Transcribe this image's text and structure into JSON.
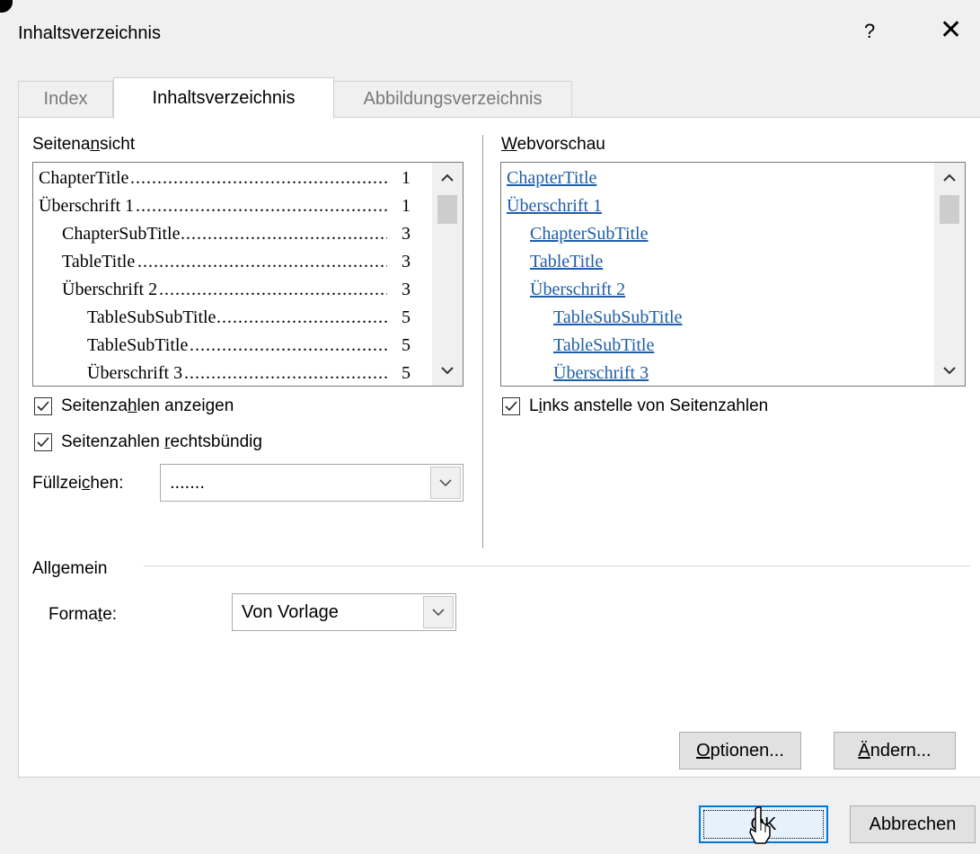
{
  "dialog": {
    "title": "Inhaltsverzeichnis",
    "help_glyph": "?",
    "close_glyph": "✕"
  },
  "tabs": [
    {
      "label": "Index",
      "active": false
    },
    {
      "label": "Inhaltsverzeichnis",
      "active": true
    },
    {
      "label": "Abbildungsverzeichnis",
      "active": false
    }
  ],
  "print_preview": {
    "label": "Seitenansicht",
    "entries": [
      {
        "text": "ChapterTitle",
        "page": "1",
        "level": 1
      },
      {
        "text": "Überschrift 1",
        "page": "1",
        "level": 1
      },
      {
        "text": "ChapterSubTitle",
        "page": "3",
        "level": 2
      },
      {
        "text": "TableTitle",
        "page": "3",
        "level": 2
      },
      {
        "text": "Überschrift 2",
        "page": "3",
        "level": 2
      },
      {
        "text": "TableSubSubTitle",
        "page": "5",
        "level": 3
      },
      {
        "text": "TableSubTitle",
        "page": "5",
        "level": 3
      },
      {
        "text": "Überschrift 3",
        "page": "5",
        "level": 3
      }
    ]
  },
  "web_preview": {
    "label": "Webvorschau",
    "entries": [
      {
        "text": "ChapterTitle",
        "level": 1
      },
      {
        "text": "Überschrift 1",
        "level": 1
      },
      {
        "text": "ChapterSubTitle",
        "level": 2
      },
      {
        "text": "TableTitle",
        "level": 2
      },
      {
        "text": "Überschrift 2",
        "level": 2
      },
      {
        "text": "TableSubSubTitle",
        "level": 3
      },
      {
        "text": "TableSubTitle",
        "level": 3
      },
      {
        "text": "Überschrift 3",
        "level": 3
      }
    ]
  },
  "options": {
    "show_page_numbers": {
      "label": "Seitenzahlen anzeigen",
      "checked": true
    },
    "right_align": {
      "label": "Seitenzahlen rechtsbündig",
      "checked": true
    },
    "tab_leader": {
      "label": "Füllzeichen:",
      "value": "......."
    },
    "hyperlinks": {
      "label": "Links anstelle von Seitenzahlen",
      "checked": true
    }
  },
  "general": {
    "label": "Allgemein",
    "formats_label": "Formate:",
    "formats_value": "Von Vorlage"
  },
  "buttons": {
    "options": "Optionen...",
    "modify": "Ändern...",
    "ok": "OK",
    "cancel": "Abbrechen"
  },
  "icons": {
    "scroll_up": "chevron-up-icon",
    "scroll_down": "chevron-down-icon",
    "dropdown": "chevron-down-icon",
    "check": "checkmark-icon",
    "cursor": "mouse-pointer-icon"
  }
}
